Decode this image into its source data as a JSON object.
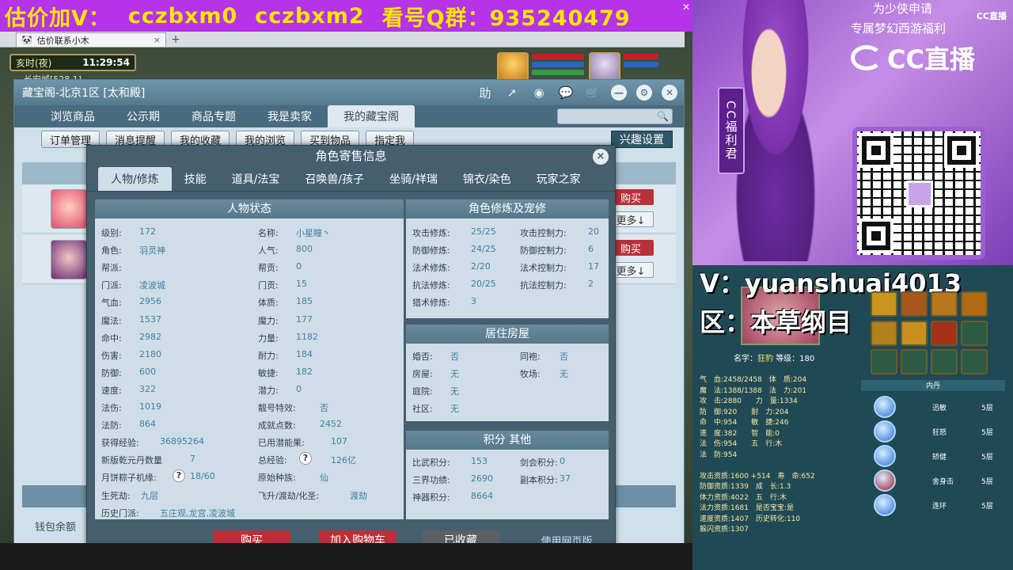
{
  "banner": {
    "prefix": "估价加V：",
    "contact1": "cczbxm0",
    "contact2": "cczbxm2",
    "qq_label": "看号Q群：",
    "qq": "935240479"
  },
  "browser": {
    "tab_title": "估价联系小木",
    "close_glyph": "×",
    "new_tab": "+"
  },
  "hud": {
    "time_label": "亥时(夜)",
    "time": "11:29:54",
    "location": "长安城[528,1]"
  },
  "window": {
    "title": "藏宝阁-北京1区 [太和殿]",
    "help": "助",
    "tabs": [
      "浏览商品",
      "公示期",
      "商品专题",
      "我是卖家",
      "我的藏宝阁"
    ],
    "subtabs": [
      "订单管理",
      "消息提醒",
      "我的收藏",
      "我的浏览",
      "买到物品",
      "指定我"
    ],
    "interest_button": "兴趣设置",
    "row_buy": "购买",
    "row_more": "更多↓",
    "wallet": "钱包余额"
  },
  "dialog": {
    "title": "角色寄售信息",
    "close": "×",
    "tabs": [
      "人物/修炼",
      "技能",
      "道具/法宝",
      "召唤兽/孩子",
      "坐骑/祥瑞",
      "锦衣/染色",
      "玩家之家"
    ],
    "status_title": "人物状态",
    "left_col": [
      {
        "k": "级别:",
        "v": "172"
      },
      {
        "k": "角色:",
        "v": "羽灵神"
      },
      {
        "k": "帮派:",
        "v": ""
      },
      {
        "k": "门派:",
        "v": "凌波城"
      },
      {
        "k": "气血:",
        "v": "2956"
      },
      {
        "k": "魔法:",
        "v": "1537"
      },
      {
        "k": "命中:",
        "v": "2982"
      },
      {
        "k": "伤害:",
        "v": "2180"
      },
      {
        "k": "防御:",
        "v": "600"
      },
      {
        "k": "速度:",
        "v": "322"
      },
      {
        "k": "法伤:",
        "v": "1019"
      },
      {
        "k": "法防:",
        "v": "864"
      },
      {
        "k": "获得经验:",
        "v": "36895264"
      },
      {
        "k": "新版乾元丹数量",
        "v": "7"
      },
      {
        "k": "月饼粽子机缘:",
        "v": "18/60"
      },
      {
        "k": "生死劫:",
        "v": "九层"
      },
      {
        "k": "历史门派:",
        "v": "五庄观,龙宫,凌波城"
      }
    ],
    "right_col": [
      {
        "k": "名称:",
        "v": "小星瞳丶"
      },
      {
        "k": "人气:",
        "v": "800"
      },
      {
        "k": "帮贡:",
        "v": "0"
      },
      {
        "k": "门贡:",
        "v": "15"
      },
      {
        "k": "体质:",
        "v": "185"
      },
      {
        "k": "魔力:",
        "v": "177"
      },
      {
        "k": "力量:",
        "v": "1182"
      },
      {
        "k": "耐力:",
        "v": "184"
      },
      {
        "k": "敏捷:",
        "v": "182"
      },
      {
        "k": "潜力:",
        "v": "0"
      },
      {
        "k": "靓号特效:",
        "v": "否"
      },
      {
        "k": "成就点数:",
        "v": "2452"
      },
      {
        "k": "已用潜能果:",
        "v": "107"
      },
      {
        "k": "总经验:",
        "v": "126亿"
      },
      {
        "k": "原始种族:",
        "v": "仙"
      },
      {
        "k": "飞升/渡劫/化圣:",
        "v": "渡劫"
      }
    ],
    "cultivation_title": "角色修炼及宠修",
    "cultivation": [
      {
        "k": "攻击修炼:",
        "v": "25/25",
        "k2": "攻击控制力:",
        "v2": "20"
      },
      {
        "k": "防御修炼:",
        "v": "24/25",
        "k2": "防御控制力:",
        "v2": "6"
      },
      {
        "k": "法术修炼:",
        "v": "2/20",
        "k2": "法术控制力:",
        "v2": "17"
      },
      {
        "k": "抗法修炼:",
        "v": "20/25",
        "k2": "抗法控制力:",
        "v2": "2"
      },
      {
        "k": "猎术修炼:",
        "v": "3",
        "k2": "",
        "v2": ""
      }
    ],
    "house_title": "居住房屋",
    "house": [
      {
        "k": "婚否:",
        "v": "否",
        "k2": "同袍:",
        "v2": "否"
      },
      {
        "k": "房屋:",
        "v": "无",
        "k2": "牧场:",
        "v2": "无"
      },
      {
        "k": "庭院:",
        "v": "无",
        "k2": "",
        "v2": ""
      },
      {
        "k": "社区:",
        "v": "无",
        "k2": "",
        "v2": ""
      }
    ],
    "score_title": "积分 其他",
    "score": [
      {
        "k": "比武积分:",
        "v": "153",
        "k2": "剑会积分:",
        "v2": "0"
      },
      {
        "k": "三界功绩:",
        "v": "2690",
        "k2": "副本积分:",
        "v2": "37"
      },
      {
        "k": "神器积分:",
        "v": "8664",
        "k2": "",
        "v2": ""
      }
    ],
    "buttons": {
      "buy": "购买",
      "cart": "加入购物车",
      "fav": "已收藏",
      "web": "使用网页版"
    }
  },
  "promo": {
    "line1": "为少侠申请",
    "line2": "专属梦幻西游福利",
    "logo_small": "CC直播",
    "logo": "CC直播",
    "ribbon": "CC福利君"
  },
  "streamer": {
    "v": "V：yuanshuai4013",
    "zone": "区：本草纲目",
    "char_label": "名字：",
    "char_name": "狂豹",
    "char_level": "等级：180",
    "stats": [
      "气　血:2458/2458　体　质:204",
      "魔　法:1388/1388　法　力:201",
      "攻　击:2880　　力　量:1334",
      "防　御:920　　耐　力:204",
      "命　中:954　　敏　捷:246",
      "速　度:382　　智　能:0",
      "法　伤:954　　五　行:木",
      "法　防:954",
      "",
      "攻击资质:1600 +514　寿　命:652",
      "防御资质:1339　成　长:1.3",
      "体力资质:4022　五　行:木",
      "法力资质:1681　是否宝宝:是",
      "速度资质:1407　历史转化:110",
      "躲闪资质:1307"
    ],
    "neidan_title": "内丹",
    "neidan": [
      {
        "n": "迅敏",
        "l": "5层",
        "c": "#2f6fd6"
      },
      {
        "n": "狂怒",
        "l": "5层",
        "c": "#2f6fd6"
      },
      {
        "n": "矫健",
        "l": "5层",
        "c": "#2f6fd6"
      },
      {
        "n": "舍身击",
        "l": "5层",
        "c": "#b0102a"
      },
      {
        "n": "连环",
        "l": "5层",
        "c": "#2f6fd6"
      }
    ]
  },
  "colors": {
    "banner_bg": "#b533e8",
    "banner_text": "#ffe600",
    "buy_red": "#b8313a",
    "dialog_bg": "#455f6f"
  }
}
